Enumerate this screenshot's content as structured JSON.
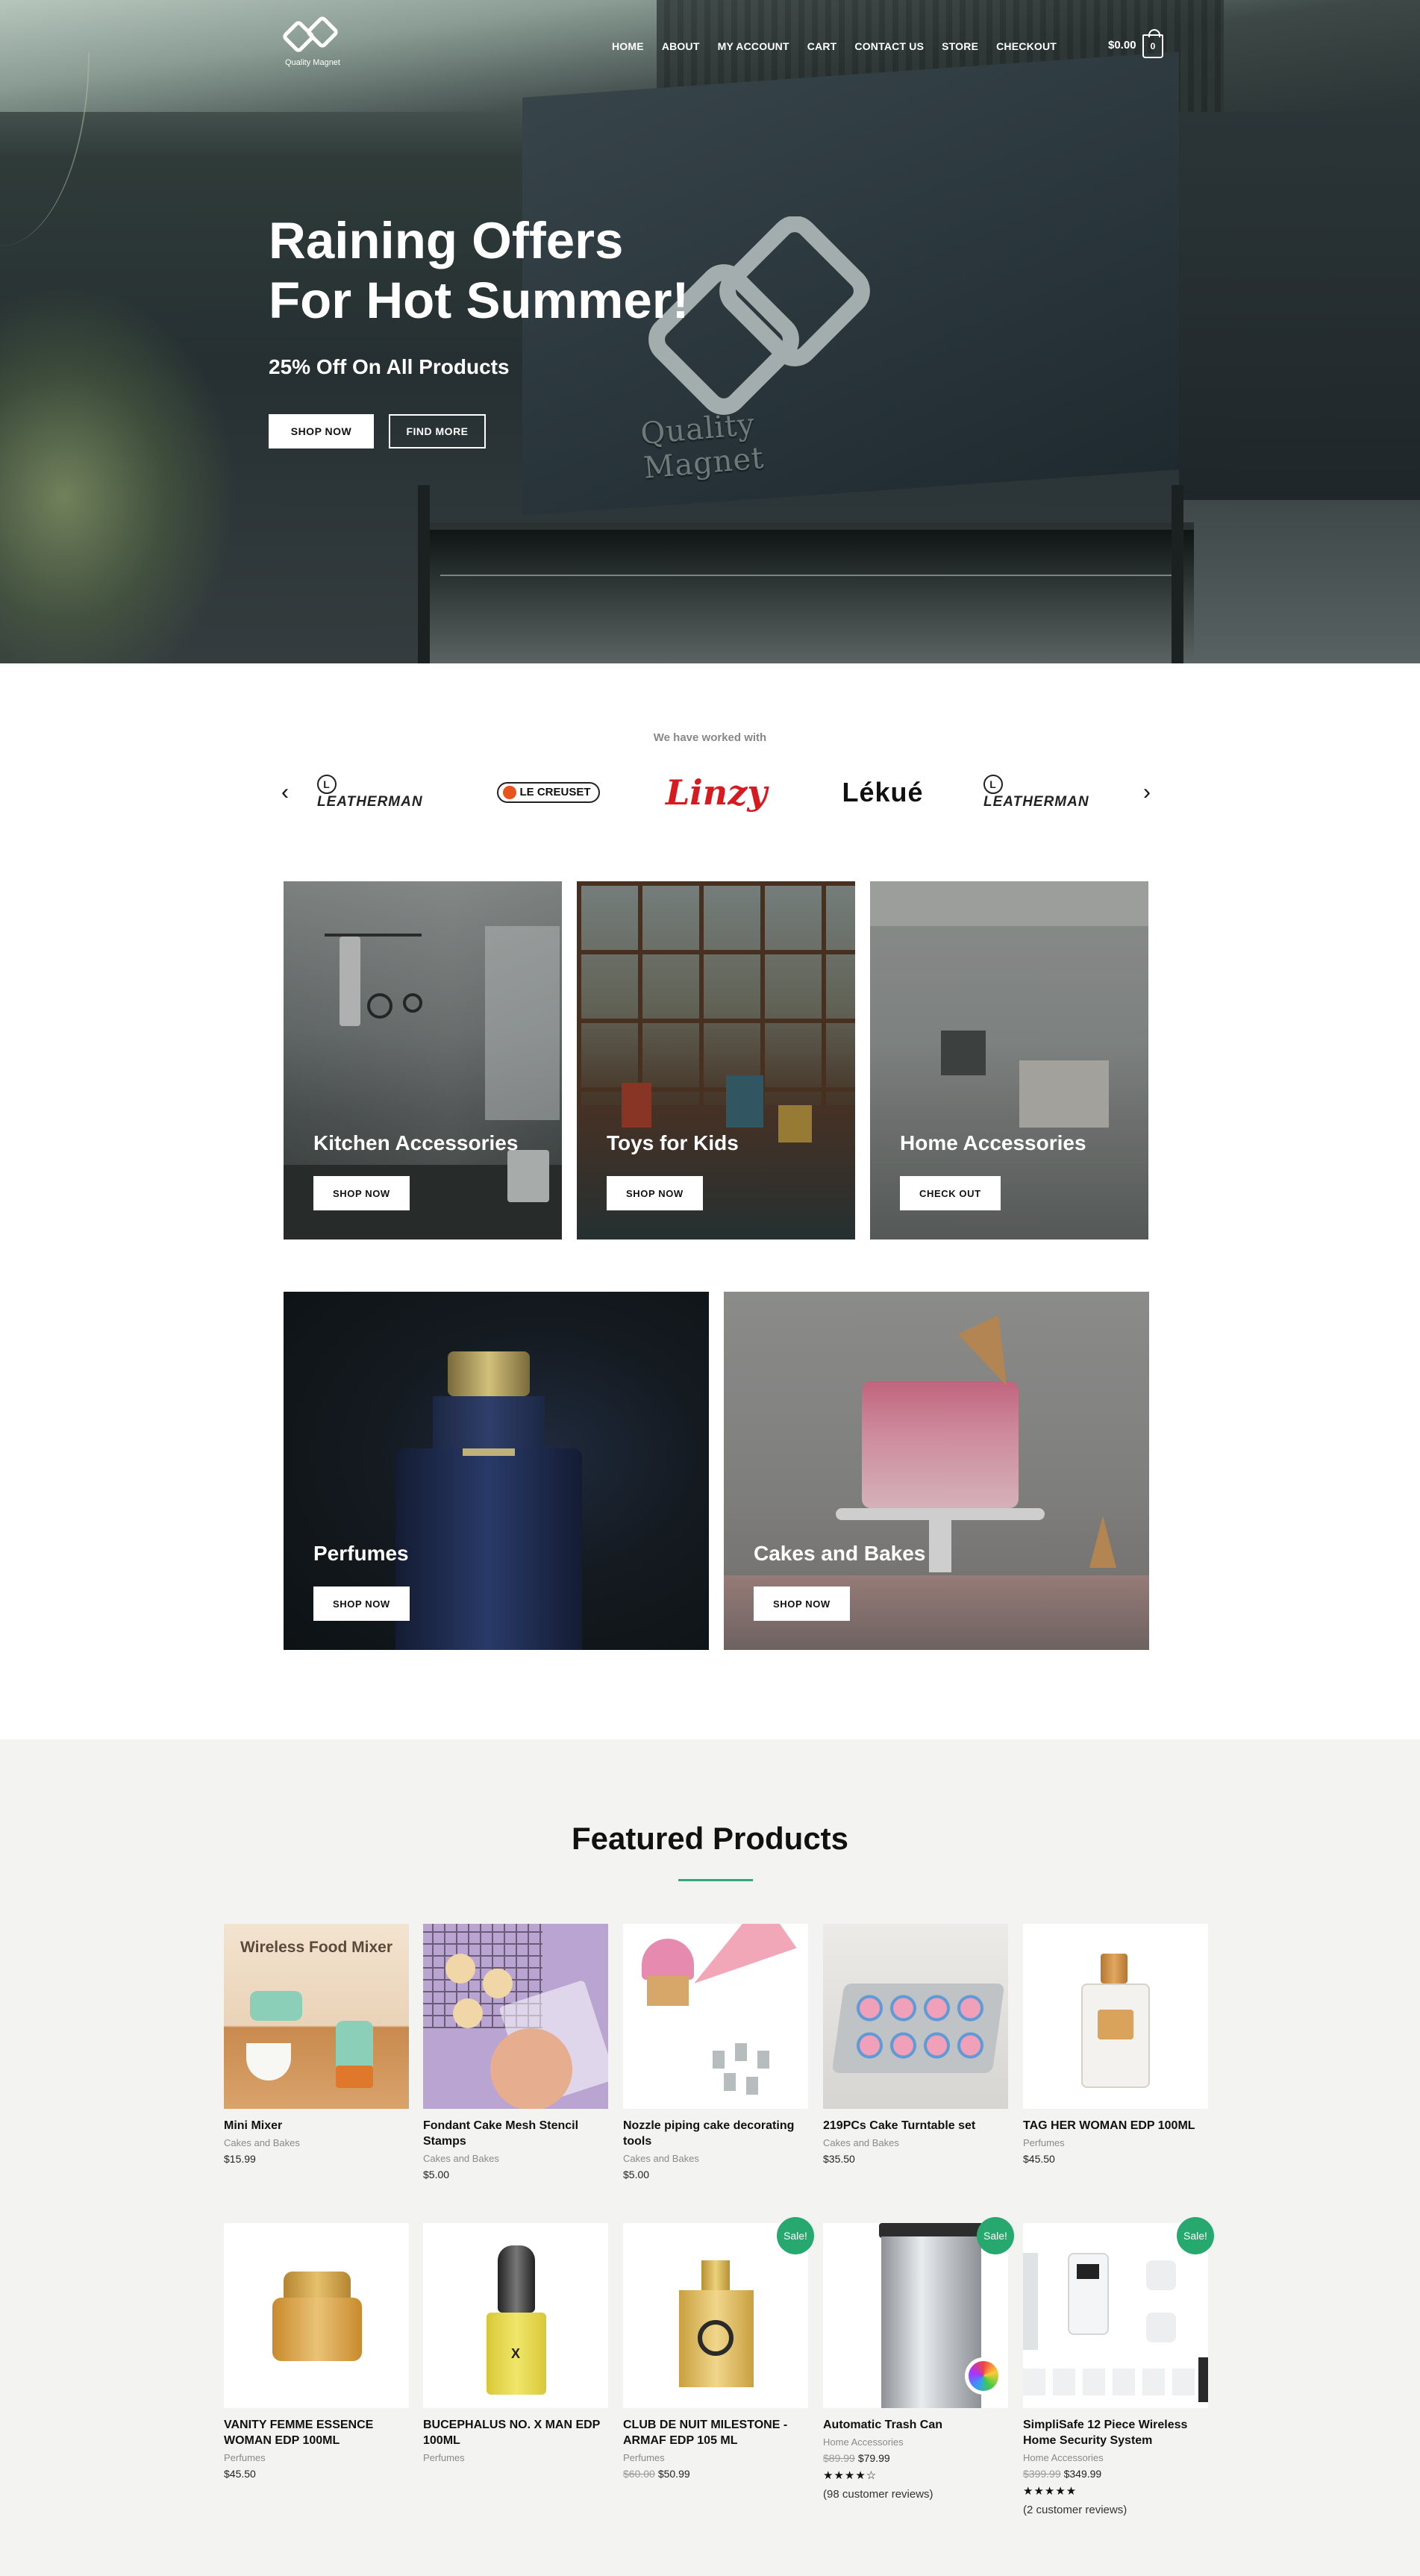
{
  "header": {
    "logo_text": "Quality Magnet",
    "nav": [
      "HOME",
      "ABOUT",
      "MY ACCOUNT",
      "CART",
      "CONTACT US",
      "STORE",
      "CHECKOUT"
    ],
    "cart_total": "$0.00",
    "cart_count": "0"
  },
  "hero": {
    "title_line1": "Raining Offers",
    "title_line2": "For Hot Summer!",
    "subtitle": "25% Off On All Products",
    "shop_now": "SHOP NOW",
    "find_more": "FIND MORE",
    "sign_text": "Quality Magnet"
  },
  "brands": {
    "title": "We have worked with",
    "items": [
      "LEATHERMAN",
      "LE CREUSET",
      "Linzy",
      "Lékué",
      "LEATHERMAN"
    ],
    "prev_icon": "‹",
    "next_icon": "›"
  },
  "categories": [
    {
      "title": "Kitchen Accessories",
      "button": "SHOP NOW"
    },
    {
      "title": "Toys for Kids",
      "button": "SHOP NOW"
    },
    {
      "title": "Home Accessories",
      "button": "CHECK OUT"
    },
    {
      "title": "Perfumes",
      "button": "SHOP NOW"
    },
    {
      "title": "Cakes and Bakes",
      "button": "SHOP NOW"
    }
  ],
  "featured": {
    "title": "Featured Products",
    "products": [
      {
        "name": "Mini Mixer",
        "category": "Cakes and Bakes",
        "price": "$15.99",
        "image_text": "Wireless Food Mixer"
      },
      {
        "name": "Fondant Cake Mesh Stencil Stamps",
        "category": "Cakes and Bakes",
        "price": "$5.00"
      },
      {
        "name": "Nozzle piping cake decorating tools",
        "category": "Cakes and Bakes",
        "price": "$5.00"
      },
      {
        "name": "219PCs Cake Turntable set",
        "category": "Cakes and Bakes",
        "price": "$35.50"
      },
      {
        "name": "TAG HER WOMAN EDP 100ML",
        "category": "Perfumes",
        "price": "$45.50"
      },
      {
        "name": "VANITY FEMME ESSENCE WOMAN EDP 100ML",
        "category": "Perfumes",
        "price": "$45.50"
      },
      {
        "name": "BUCEPHALUS NO. X MAN EDP 100ML",
        "category": "Perfumes",
        "price": ""
      },
      {
        "name": "CLUB DE NUIT MILESTONE - ARMAF EDP 105 ML",
        "category": "Perfumes",
        "old_price": "$60.00",
        "price": "$50.99",
        "badge": "Sale!"
      },
      {
        "name": "Automatic Trash Can",
        "category": "Home Accessories",
        "old_price": "$89.99",
        "price": "$79.99",
        "badge": "Sale!",
        "rating": 4,
        "stars": "★★★★☆",
        "reviews": "(98 customer reviews)"
      },
      {
        "name": "SimpliSafe 12 Piece Wireless Home Security System",
        "category": "Home Accessories",
        "old_price": "$399.99",
        "price": "$349.99",
        "badge": "Sale!",
        "rating": 5,
        "stars": "★★★★★",
        "reviews": "(2 customer reviews)"
      }
    ]
  },
  "colors": {
    "accent": "#2fa87b",
    "sale_badge": "#27a86f",
    "featured_bg": "#f3f4f1",
    "linzy_red": "#d71920"
  }
}
